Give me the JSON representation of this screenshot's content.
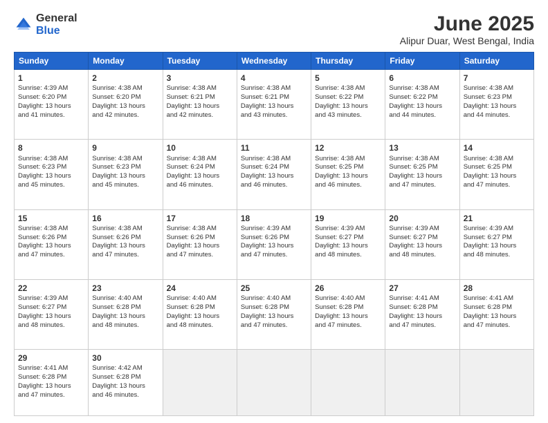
{
  "logo": {
    "general": "General",
    "blue": "Blue"
  },
  "header": {
    "title": "June 2025",
    "subtitle": "Alipur Duar, West Bengal, India"
  },
  "days": [
    "Sunday",
    "Monday",
    "Tuesday",
    "Wednesday",
    "Thursday",
    "Friday",
    "Saturday"
  ],
  "weeks": [
    [
      {
        "num": "1",
        "info": "Sunrise: 4:39 AM\nSunset: 6:20 PM\nDaylight: 13 hours\nand 41 minutes."
      },
      {
        "num": "2",
        "info": "Sunrise: 4:38 AM\nSunset: 6:20 PM\nDaylight: 13 hours\nand 42 minutes."
      },
      {
        "num": "3",
        "info": "Sunrise: 4:38 AM\nSunset: 6:21 PM\nDaylight: 13 hours\nand 42 minutes."
      },
      {
        "num": "4",
        "info": "Sunrise: 4:38 AM\nSunset: 6:21 PM\nDaylight: 13 hours\nand 43 minutes."
      },
      {
        "num": "5",
        "info": "Sunrise: 4:38 AM\nSunset: 6:22 PM\nDaylight: 13 hours\nand 43 minutes."
      },
      {
        "num": "6",
        "info": "Sunrise: 4:38 AM\nSunset: 6:22 PM\nDaylight: 13 hours\nand 44 minutes."
      },
      {
        "num": "7",
        "info": "Sunrise: 4:38 AM\nSunset: 6:23 PM\nDaylight: 13 hours\nand 44 minutes."
      }
    ],
    [
      {
        "num": "8",
        "info": "Sunrise: 4:38 AM\nSunset: 6:23 PM\nDaylight: 13 hours\nand 45 minutes."
      },
      {
        "num": "9",
        "info": "Sunrise: 4:38 AM\nSunset: 6:23 PM\nDaylight: 13 hours\nand 45 minutes."
      },
      {
        "num": "10",
        "info": "Sunrise: 4:38 AM\nSunset: 6:24 PM\nDaylight: 13 hours\nand 46 minutes."
      },
      {
        "num": "11",
        "info": "Sunrise: 4:38 AM\nSunset: 6:24 PM\nDaylight: 13 hours\nand 46 minutes."
      },
      {
        "num": "12",
        "info": "Sunrise: 4:38 AM\nSunset: 6:25 PM\nDaylight: 13 hours\nand 46 minutes."
      },
      {
        "num": "13",
        "info": "Sunrise: 4:38 AM\nSunset: 6:25 PM\nDaylight: 13 hours\nand 47 minutes."
      },
      {
        "num": "14",
        "info": "Sunrise: 4:38 AM\nSunset: 6:25 PM\nDaylight: 13 hours\nand 47 minutes."
      }
    ],
    [
      {
        "num": "15",
        "info": "Sunrise: 4:38 AM\nSunset: 6:26 PM\nDaylight: 13 hours\nand 47 minutes."
      },
      {
        "num": "16",
        "info": "Sunrise: 4:38 AM\nSunset: 6:26 PM\nDaylight: 13 hours\nand 47 minutes."
      },
      {
        "num": "17",
        "info": "Sunrise: 4:38 AM\nSunset: 6:26 PM\nDaylight: 13 hours\nand 47 minutes."
      },
      {
        "num": "18",
        "info": "Sunrise: 4:39 AM\nSunset: 6:26 PM\nDaylight: 13 hours\nand 47 minutes."
      },
      {
        "num": "19",
        "info": "Sunrise: 4:39 AM\nSunset: 6:27 PM\nDaylight: 13 hours\nand 48 minutes."
      },
      {
        "num": "20",
        "info": "Sunrise: 4:39 AM\nSunset: 6:27 PM\nDaylight: 13 hours\nand 48 minutes."
      },
      {
        "num": "21",
        "info": "Sunrise: 4:39 AM\nSunset: 6:27 PM\nDaylight: 13 hours\nand 48 minutes."
      }
    ],
    [
      {
        "num": "22",
        "info": "Sunrise: 4:39 AM\nSunset: 6:27 PM\nDaylight: 13 hours\nand 48 minutes."
      },
      {
        "num": "23",
        "info": "Sunrise: 4:40 AM\nSunset: 6:28 PM\nDaylight: 13 hours\nand 48 minutes."
      },
      {
        "num": "24",
        "info": "Sunrise: 4:40 AM\nSunset: 6:28 PM\nDaylight: 13 hours\nand 48 minutes."
      },
      {
        "num": "25",
        "info": "Sunrise: 4:40 AM\nSunset: 6:28 PM\nDaylight: 13 hours\nand 47 minutes."
      },
      {
        "num": "26",
        "info": "Sunrise: 4:40 AM\nSunset: 6:28 PM\nDaylight: 13 hours\nand 47 minutes."
      },
      {
        "num": "27",
        "info": "Sunrise: 4:41 AM\nSunset: 6:28 PM\nDaylight: 13 hours\nand 47 minutes."
      },
      {
        "num": "28",
        "info": "Sunrise: 4:41 AM\nSunset: 6:28 PM\nDaylight: 13 hours\nand 47 minutes."
      }
    ],
    [
      {
        "num": "29",
        "info": "Sunrise: 4:41 AM\nSunset: 6:28 PM\nDaylight: 13 hours\nand 47 minutes."
      },
      {
        "num": "30",
        "info": "Sunrise: 4:42 AM\nSunset: 6:28 PM\nDaylight: 13 hours\nand 46 minutes."
      },
      {
        "num": "",
        "info": "",
        "empty": true
      },
      {
        "num": "",
        "info": "",
        "empty": true
      },
      {
        "num": "",
        "info": "",
        "empty": true
      },
      {
        "num": "",
        "info": "",
        "empty": true
      },
      {
        "num": "",
        "info": "",
        "empty": true
      }
    ]
  ]
}
